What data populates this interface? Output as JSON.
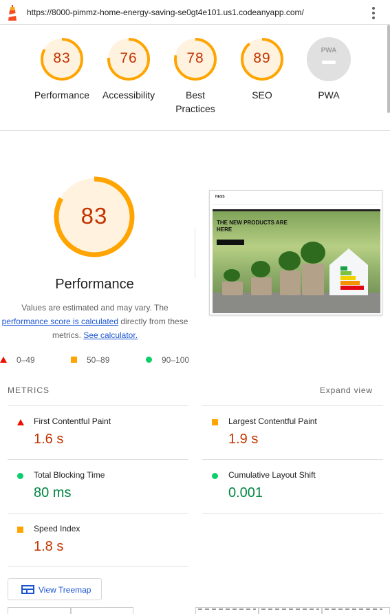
{
  "browser": {
    "url": "https://8000-pimmz-home-energy-saving-se0gt4e101.us1.codeanyapp.com/",
    "menu_icon": "more-vert-icon",
    "app_icon": "lighthouse-icon"
  },
  "colors": {
    "fail": "#eb0f00",
    "average": "#ffa400",
    "pass": "#0cce6b",
    "average_text": "#c33300",
    "pass_text": "#018642",
    "link": "#1a55d1"
  },
  "summary": [
    {
      "score": "83",
      "score_value": 83,
      "label": "Performance"
    },
    {
      "score": "76",
      "score_value": 76,
      "label": "Accessibility"
    },
    {
      "score": "78",
      "score_value": 78,
      "label": "Best Practices",
      "label_line1": "Best",
      "label_line2": "Practices"
    },
    {
      "score": "89",
      "score_value": 89,
      "label": "SEO"
    },
    {
      "score": "PWA",
      "label": "PWA"
    }
  ],
  "performance": {
    "score": "83",
    "score_value": 83,
    "title": "Performance",
    "desc_prefix": "Values are estimated and may vary. The",
    "desc_link": "performance score is calculated",
    "desc_mid": "directly from these",
    "desc_suffix": "metrics.",
    "calc_link": "See calculator."
  },
  "thumbnail": {
    "brand": "HESS",
    "hero_text": "THE NEW PRODUCTS ARE HERE"
  },
  "legend": [
    {
      "range": "0–49",
      "shape": "triangle"
    },
    {
      "range": "50–89",
      "shape": "square"
    },
    {
      "range": "90–100",
      "shape": "circle"
    }
  ],
  "metrics": {
    "heading": "METRICS",
    "expand_label": "Expand view",
    "items": [
      {
        "name": "First Contentful Paint",
        "value": "1.6 s",
        "rating": "fail"
      },
      {
        "name": "Largest Contentful Paint",
        "value": "1.9 s",
        "rating": "average"
      },
      {
        "name": "Total Blocking Time",
        "value": "80 ms",
        "rating": "pass"
      },
      {
        "name": "Cumulative Layout Shift",
        "value": "0.001",
        "rating": "pass"
      },
      {
        "name": "Speed Index",
        "value": "1.8 s",
        "rating": "average"
      }
    ]
  },
  "treemap": {
    "label": "View Treemap",
    "icon": "treemap-icon"
  }
}
